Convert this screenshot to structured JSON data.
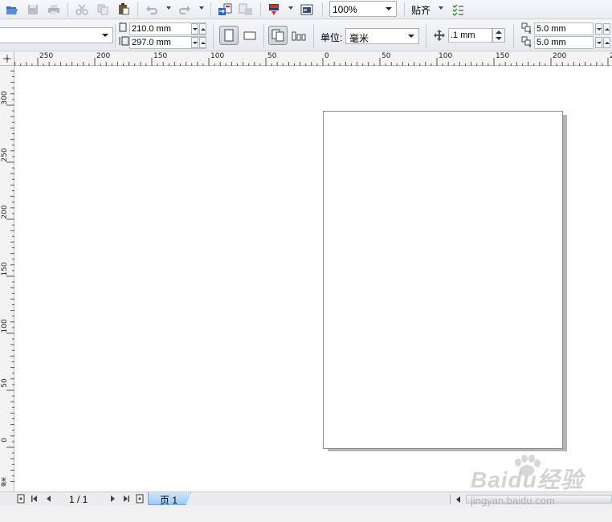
{
  "standard_toolbar": {
    "icons": [
      "open-icon",
      "save-icon",
      "print-icon",
      "cut-icon",
      "copy-icon",
      "paste-icon",
      "undo-icon",
      "redo-icon",
      "import-icon",
      "export-icon",
      "application-launcher-icon",
      "welcome-screen-icon",
      "snap-options-icon"
    ],
    "zoom_level": "100%",
    "snap_label": "贴齐"
  },
  "property_bar": {
    "paper_size": "",
    "width_value": "210.0 mm",
    "height_value": "297.0 mm",
    "units_label": "单位:",
    "units_value": "毫米",
    "nudge_value": ".1 mm",
    "duplicate_h_value": "5.0 mm",
    "duplicate_v_value": "5.0 mm"
  },
  "rulers": {
    "horizontal_labels": [
      "250",
      "200",
      "150",
      "100",
      "50",
      "0",
      "50",
      "100",
      "150",
      "200",
      "250"
    ],
    "vertical_labels": [
      "300",
      "250",
      "200",
      "150",
      "100",
      "50",
      "0"
    ],
    "unit_glyph": "毫米"
  },
  "page_navigator": {
    "page_counter": "1 / 1",
    "active_page_tab": "页 1"
  },
  "watermark": {
    "logo_text": "Baidu经验",
    "url_text": "jingyan.baidu.com"
  },
  "colors": {
    "page_shadow": "#b4b4b4",
    "page_tab": "#9cccf3",
    "toolbar_bg": "#eceef2"
  }
}
